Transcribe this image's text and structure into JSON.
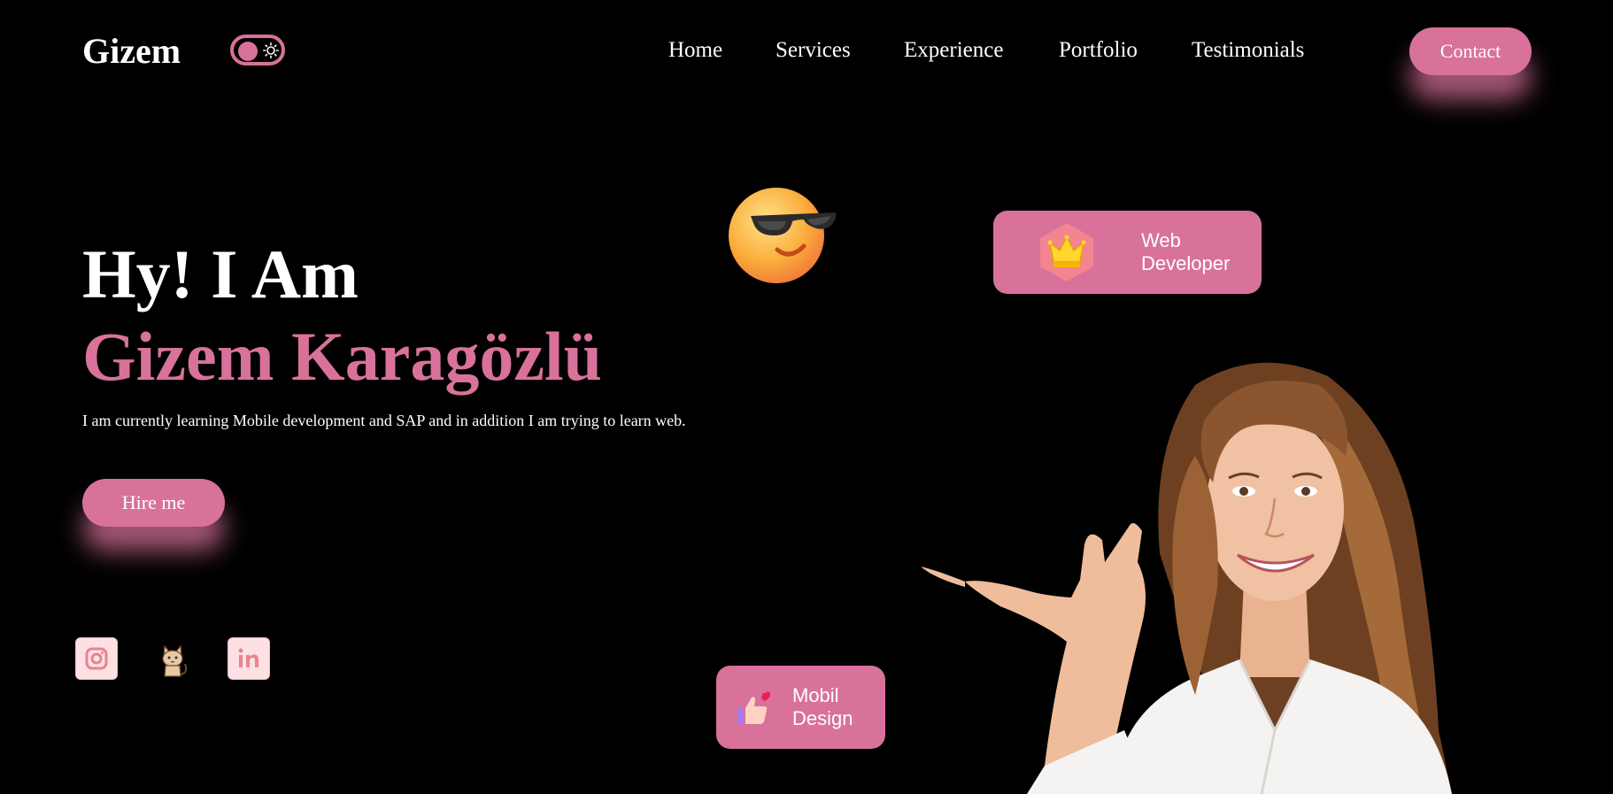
{
  "header": {
    "logo": "Gizem",
    "nav": [
      "Home",
      "Services",
      "Experience",
      "Portfolio",
      "Testimonials"
    ],
    "contact_label": "Contact"
  },
  "hero": {
    "greeting": "Hy! I Am",
    "name": "Gizem Karagözlü",
    "description": "I am currently learning Mobile development and SAP and in addition I am trying to learn web.",
    "hire_label": "Hire me"
  },
  "social": [
    "instagram-icon",
    "github-icon",
    "linkedin-icon"
  ],
  "badges": {
    "web_line1": "Web",
    "web_line2": "Developer",
    "mobil_line1": "Mobil",
    "mobil_line2": "Design"
  },
  "colors": {
    "accent": "#d8729a",
    "background": "#000000",
    "text": "#ffffff"
  }
}
